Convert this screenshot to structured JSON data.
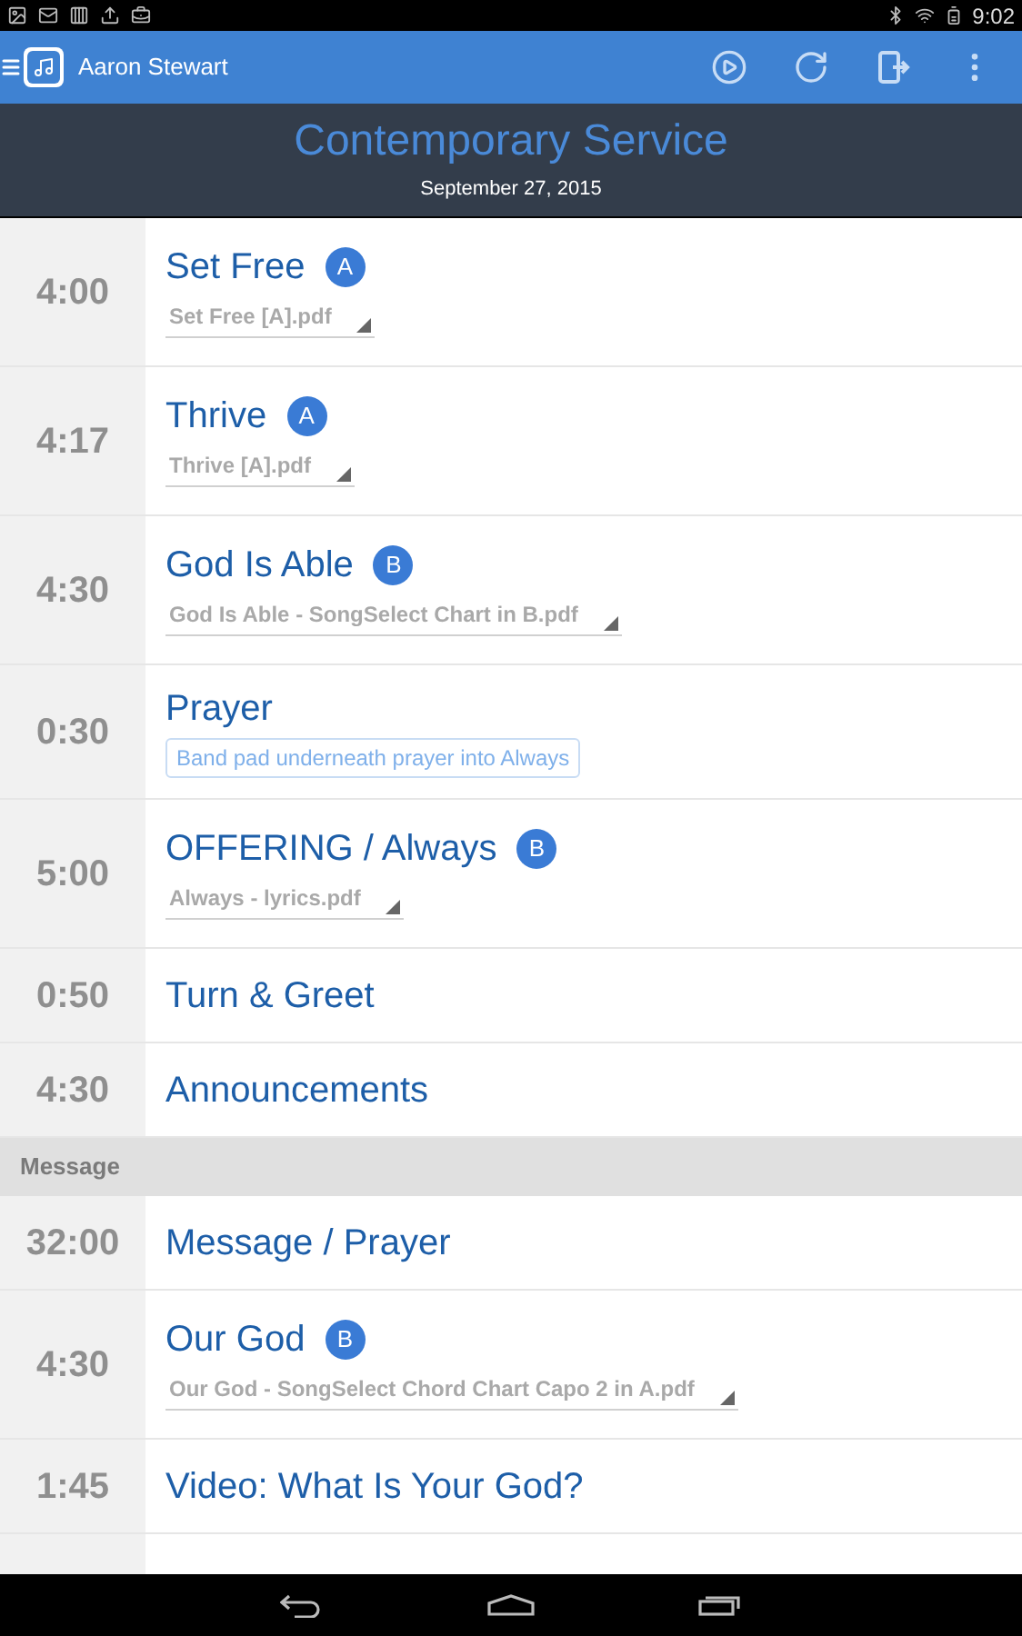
{
  "status_bar": {
    "time": "9:02"
  },
  "app_bar": {
    "title": "Aaron Stewart"
  },
  "header": {
    "title": "Contemporary Service",
    "date": "September 27, 2015"
  },
  "items": [
    {
      "kind": "song",
      "time": "4:00",
      "title": "Set Free",
      "key": "A",
      "file": "Set Free [A].pdf"
    },
    {
      "kind": "song",
      "time": "4:17",
      "title": "Thrive",
      "key": "A",
      "file": "Thrive [A].pdf"
    },
    {
      "kind": "song",
      "time": "4:30",
      "title": "God Is Able",
      "key": "B",
      "file": "God Is Able - SongSelect Chart in B.pdf"
    },
    {
      "kind": "note",
      "time": "0:30",
      "title": "Prayer",
      "note": "Band pad underneath prayer into Always"
    },
    {
      "kind": "song",
      "time": "5:00",
      "title": "OFFERING / Always",
      "key": "B",
      "file": "Always - lyrics.pdf"
    },
    {
      "kind": "plain",
      "time": "0:50",
      "title": "Turn & Greet"
    },
    {
      "kind": "plain",
      "time": "4:30",
      "title": "Announcements"
    },
    {
      "kind": "section",
      "title": "Message"
    },
    {
      "kind": "plain",
      "time": "32:00",
      "title": "Message / Prayer"
    },
    {
      "kind": "song",
      "time": "4:30",
      "title": "Our God",
      "key": "B",
      "file": "Our God - SongSelect Chord Chart Capo 2 in A.pdf"
    },
    {
      "kind": "plain",
      "time": "1:45",
      "title": "Video: What Is Your God?"
    }
  ]
}
